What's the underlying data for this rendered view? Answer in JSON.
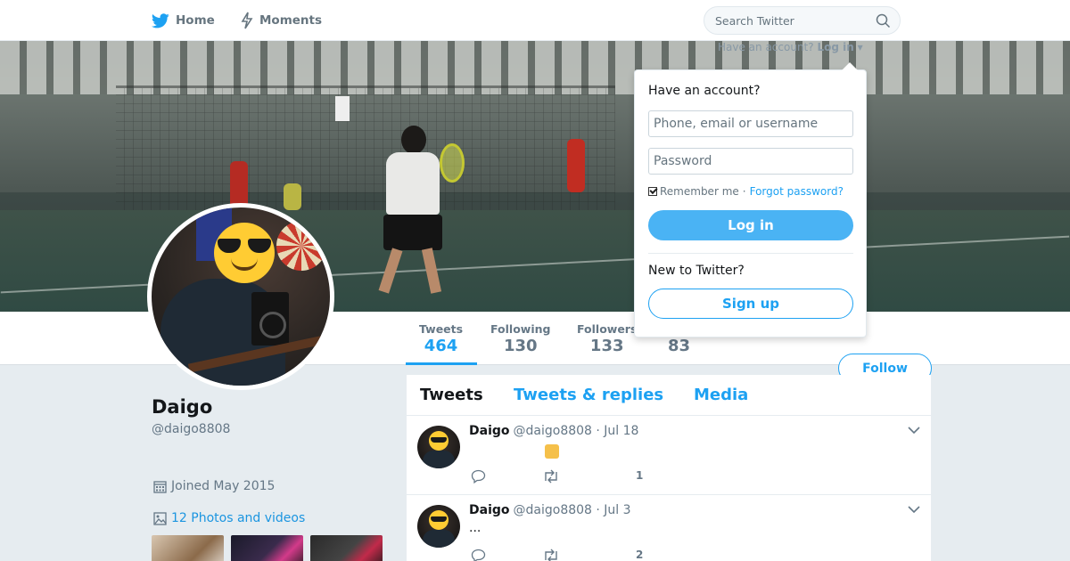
{
  "nav": {
    "home_label": "Home",
    "moments_label": "Moments",
    "search_placeholder": "Search Twitter",
    "login_prompt": "Have an account?",
    "login_link": "Log in"
  },
  "colors": {
    "accent": "#1da1f2",
    "login_button": "#4ab3f4",
    "page_background": "#e6ecf0"
  },
  "icons": [
    "twitter-bird-icon",
    "moments-bolt-icon",
    "search-icon",
    "calendar-icon",
    "photo-icon",
    "caret-down-icon",
    "reply-icon",
    "retweet-icon",
    "like-icon"
  ],
  "profile": {
    "name": "Daigo",
    "handle": "@daigo8808",
    "joined": "Joined May 2015",
    "photos_link": "12 Photos and videos"
  },
  "stats": [
    {
      "label": "Tweets",
      "value": "464"
    },
    {
      "label": "Following",
      "value": "130"
    },
    {
      "label": "Followers",
      "value": "133"
    },
    {
      "label": "",
      "value": "83"
    }
  ],
  "follow_label": "Follow",
  "timeline": {
    "tabs": [
      "Tweets",
      "Tweets & replies",
      "Media"
    ],
    "tweets": [
      {
        "name": "Daigo",
        "meta": "@daigo8808 · Jul 18",
        "text": "",
        "like_count": "1"
      },
      {
        "name": "Daigo",
        "meta": "@daigo8808 · Jul 3",
        "text": "...",
        "like_count": "2"
      }
    ]
  },
  "login_dropdown": {
    "title": "Have an account?",
    "username_placeholder": "Phone, email or username",
    "password_placeholder": "Password",
    "remember_label": "Remember me",
    "separator": "·",
    "forgot_label": "Forgot password?",
    "login_button": "Log in",
    "new_label": "New to Twitter?",
    "signup_button": "Sign up"
  }
}
